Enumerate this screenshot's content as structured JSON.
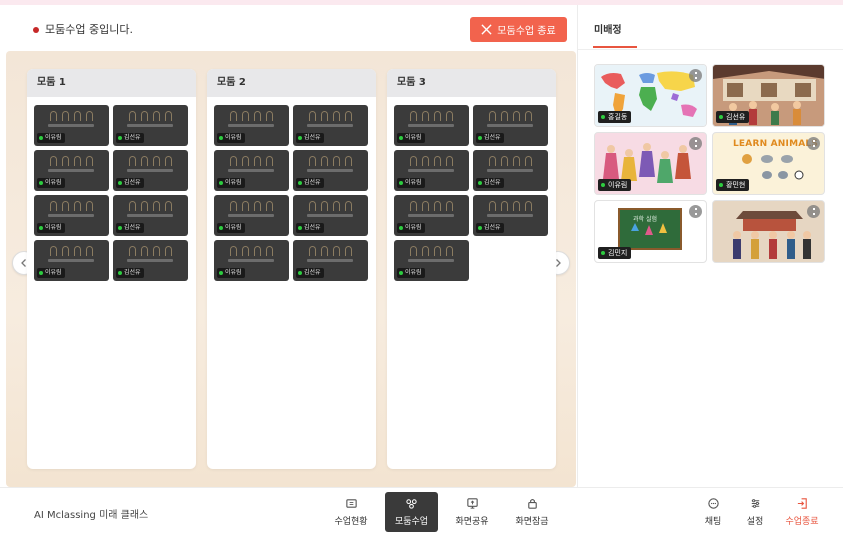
{
  "status": {
    "text": "모둠수업 중입니다.",
    "end_button": "모둠수업 종료"
  },
  "groups": [
    {
      "title": "모둠 1",
      "members": [
        "이유림",
        "김선유",
        "이유림",
        "김선유",
        "이유림",
        "김선유",
        "이유림",
        "김선유"
      ]
    },
    {
      "title": "모둠 2",
      "members": [
        "이유림",
        "김선유",
        "이유림",
        "김선유",
        "이유림",
        "김선유",
        "이유림",
        "김선유"
      ]
    },
    {
      "title": "모둠 3",
      "members": [
        "이유림",
        "김선유",
        "이유림",
        "김선유",
        "이유림",
        "김선유",
        "이유림"
      ]
    }
  ],
  "side": {
    "tab": "미배정",
    "cards": [
      {
        "name": "홍길동",
        "scene": "world-map"
      },
      {
        "name": "김선유",
        "scene": "korean-village"
      },
      {
        "name": "이유림",
        "scene": "traditional-costumes"
      },
      {
        "name": "황민현",
        "scene": "learn-animals",
        "caption": "LEARN ANIMALS"
      },
      {
        "name": "김민지",
        "scene": "science-lab",
        "caption": "과학 실험"
      },
      {
        "name": "",
        "scene": "palace-guards"
      }
    ]
  },
  "bottom": {
    "brand": "AI Mclassing 미래 클래스",
    "tools": [
      {
        "label": "수업현황",
        "icon": "status-icon"
      },
      {
        "label": "모둠수업",
        "icon": "group-icon",
        "active": true
      },
      {
        "label": "화면공유",
        "icon": "screen-share-icon"
      },
      {
        "label": "화면잠금",
        "icon": "lock-icon"
      }
    ],
    "right_tools": [
      {
        "label": "채팅",
        "icon": "chat-icon"
      },
      {
        "label": "설정",
        "icon": "settings-icon"
      },
      {
        "label": "수업종료",
        "icon": "exit-icon"
      }
    ]
  },
  "colors": {
    "accent": "#f2634d",
    "danger": "#e8553f",
    "live_dot": "#2ecc40"
  }
}
